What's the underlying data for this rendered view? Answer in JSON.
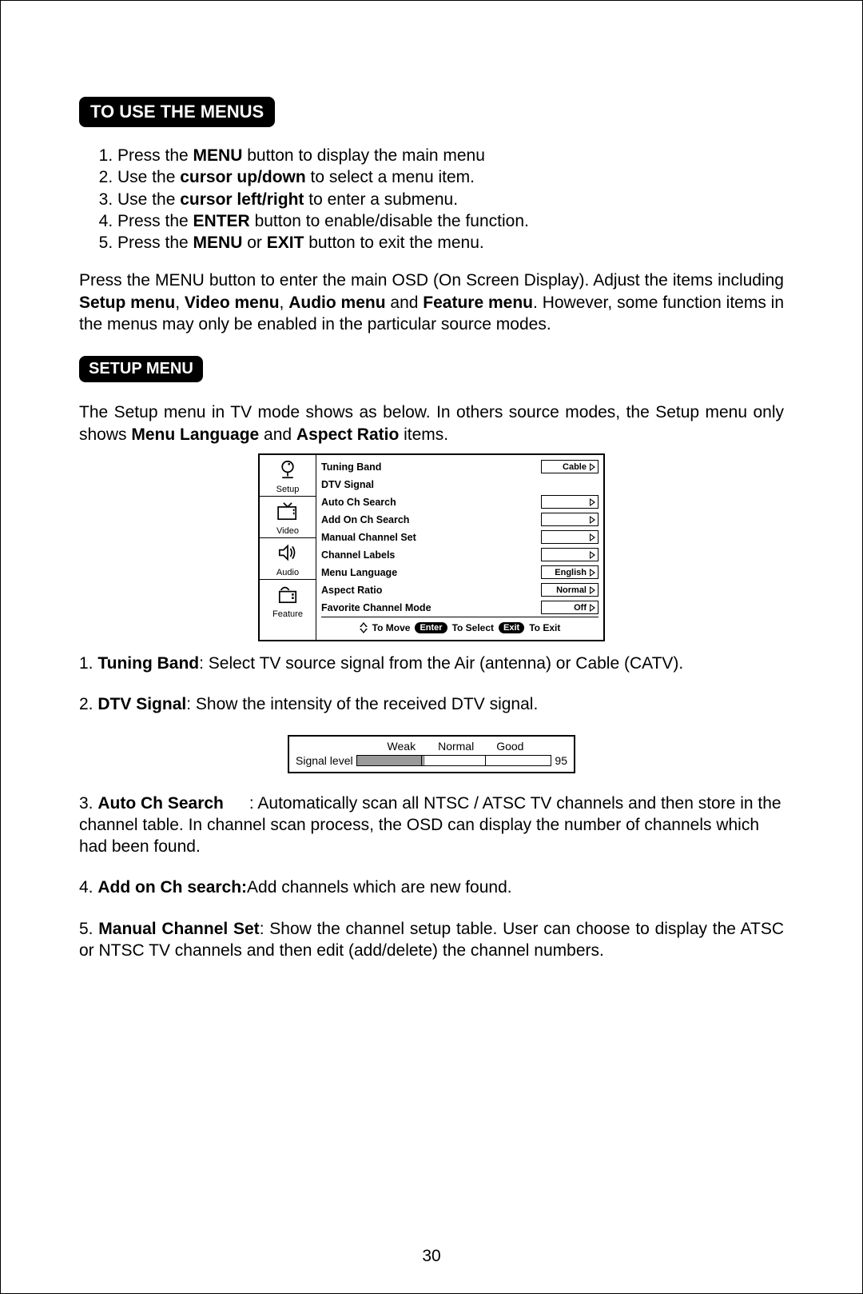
{
  "page_number": "30",
  "headings": {
    "to_use_menus": "TO USE THE MENUS",
    "setup_menu": "SETUP MENU"
  },
  "steps": [
    {
      "pre": "Press the ",
      "bold": "MENU",
      "post": " button to display the main menu"
    },
    {
      "pre": "Use the ",
      "bold": "cursor up/down",
      "post": " to select a menu item."
    },
    {
      "pre": "Use the ",
      "bold": "cursor left/right",
      "post": " to enter a submenu."
    },
    {
      "pre": "Press the ",
      "bold": "ENTER",
      "post": " button to enable/disable the function."
    },
    {
      "pre": "Press the ",
      "bold": "MENU",
      "mid": " or ",
      "bold2": "EXIT",
      "post": " button to exit the menu."
    }
  ],
  "para_osd": {
    "pre": "Press the MENU button to enter the main OSD (On Screen Display). Adjust the items including ",
    "b1": "Setup menu",
    "s1": ", ",
    "b2": "Video menu",
    "s2": ", ",
    "b3": "Audio menu",
    "s3": " and ",
    "b4": "Feature menu",
    "post": ". However, some function items in the menus may only be enabled in the particular source modes."
  },
  "para_setup": {
    "pre": "The Setup menu in TV mode shows as below. In others source modes, the Setup menu only shows ",
    "b1": "Menu Language",
    "s1": " and ",
    "b2": "Aspect Ratio",
    "post": " items."
  },
  "osd": {
    "tabs": [
      "Setup",
      "Video",
      "Audio",
      "Feature"
    ],
    "rows": [
      {
        "label": "Tuning Band",
        "value": "Cable"
      },
      {
        "label": "DTV Signal",
        "value": ""
      },
      {
        "label": "Auto Ch Search",
        "value": ""
      },
      {
        "label": "Add On Ch Search",
        "value": ""
      },
      {
        "label": "Manual Channel Set",
        "value": ""
      },
      {
        "label": "Channel Labels",
        "value": ""
      },
      {
        "label": "Menu Language",
        "value": "English"
      },
      {
        "label": "Aspect Ratio",
        "value": "Normal"
      },
      {
        "label": "Favorite Channel Mode",
        "value": "Off"
      }
    ],
    "footer": {
      "move": "To Move",
      "enter": "Enter",
      "select": "To Select",
      "exit": "Exit",
      "toexit": "To Exit"
    }
  },
  "signal": {
    "labels": [
      "Weak",
      "Normal",
      "Good"
    ],
    "caption": "Signal level",
    "value": "95"
  },
  "descriptions": {
    "d1": {
      "num": "1. ",
      "bold": "Tuning Band",
      "text": ": Select TV source signal from the Air (antenna) or Cable (CATV)."
    },
    "d2": {
      "num": "2. ",
      "bold": "DTV Signal",
      "text": ": Show the intensity of the received DTV signal."
    },
    "d3": {
      "num": "3. ",
      "bold": "Auto Ch Search",
      "text": ": Automatically scan all NTSC / ATSC TV channels and then store in the channel table. In channel scan process, the OSD can display the number of channels which had been found."
    },
    "d4": {
      "num": "4. ",
      "bold": "Add on Ch search:",
      "text": "Add channels which are new found."
    },
    "d5": {
      "num": "5. ",
      "bold": "Manual Channel Set",
      "text": ": Show the channel setup table. User can choose to display the ATSC or NTSC TV channels and then edit (add/delete) the channel numbers."
    }
  }
}
